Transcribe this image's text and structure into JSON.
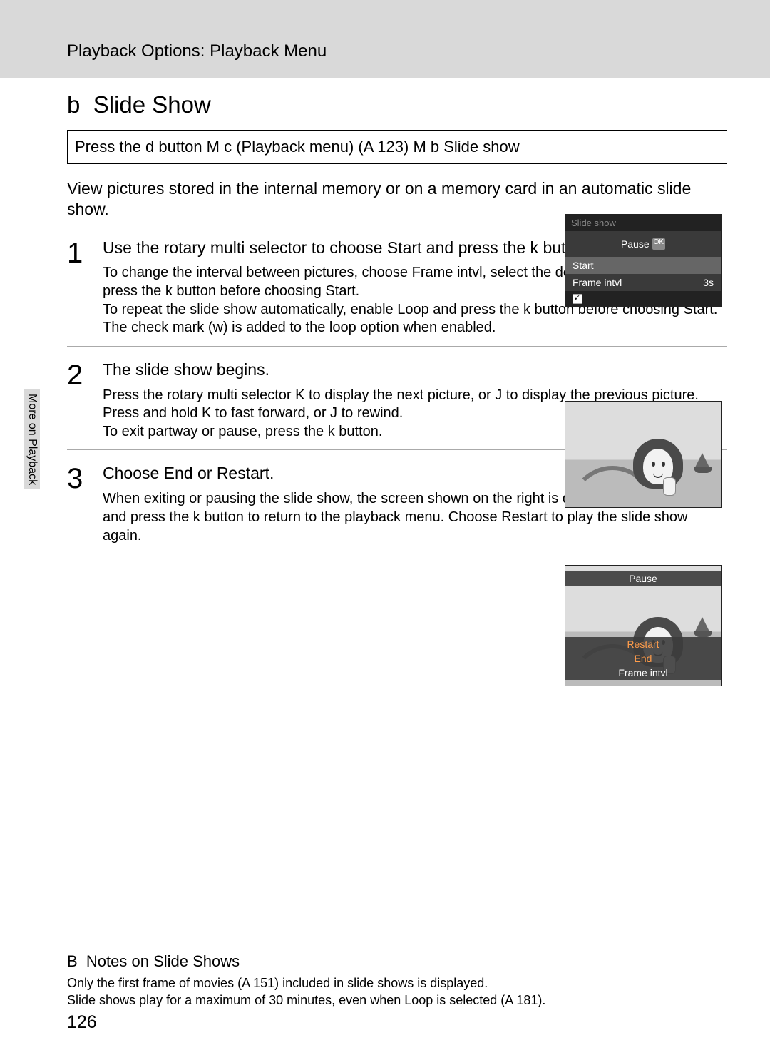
{
  "header": {
    "breadcrumb": "Playback Options: Playback Menu"
  },
  "side_tab": "More on Playback",
  "page_number": "126",
  "title_prefix": "b",
  "title": "Slide Show",
  "nav_path": "Press the d button M c (Playback menu) (A 123) M b Slide show",
  "intro": "View pictures stored in the internal memory or on a memory card in an automatic slide show.",
  "steps": [
    {
      "num": "1",
      "head": "Use the rotary multi selector to choose Start and press the k button.",
      "sub": "To change the interval between pictures, choose Frame intvl, select the desired interval time, and press the k button before choosing Start.\nTo repeat the slide show automatically, enable Loop and press the k button before choosing Start. The check mark (w) is added to the loop option when enabled."
    },
    {
      "num": "2",
      "head": "The slide show begins.",
      "sub": "Press the rotary multi selector K to display the next picture, or J to display the previous picture. Press and hold K to fast forward, or J to rewind.\nTo exit partway or pause, press the k button."
    },
    {
      "num": "3",
      "head": "Choose End or Restart.",
      "sub": "When exiting or pausing the slide show, the screen shown on the right is displayed. Choose End and press the k button to return to the playback menu. Choose Restart to play the slide show again."
    }
  ],
  "notes": {
    "prefix": "B",
    "head": "Notes on Slide Shows",
    "body": "Only the first frame of movies (A 151) included in slide shows is displayed.\nSlide shows play for a maximum of 30 minutes, even when Loop is selected (A 181)."
  },
  "fig1": {
    "header": "Slide show",
    "pause": "Pause",
    "start": "Start",
    "frame_label": "Frame intvl",
    "frame_val": "3s"
  },
  "fig3": {
    "pause": "Pause",
    "restart": "Restart",
    "end": "End",
    "frame": "Frame intvl"
  }
}
